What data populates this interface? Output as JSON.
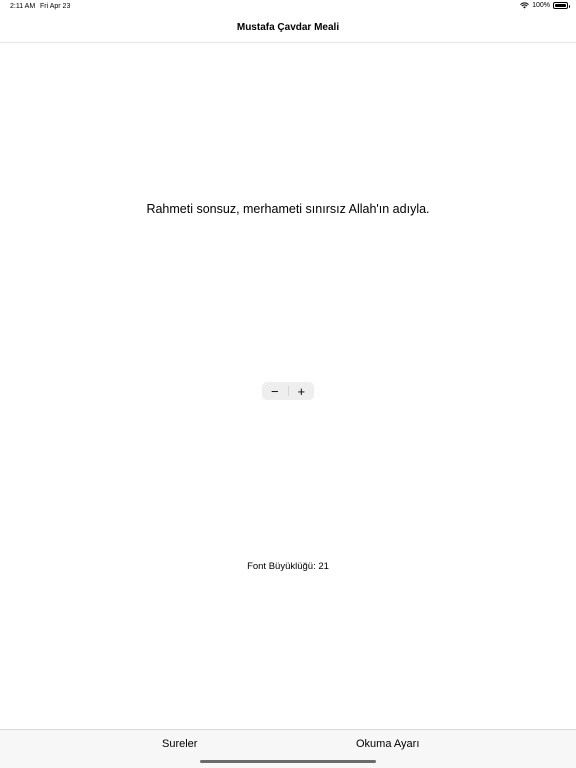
{
  "status_bar": {
    "time": "2:11 AM",
    "date": "Fri Apr 23",
    "battery": "100%",
    "battery_level": 1.0,
    "wifi_icon": "wifi-icon",
    "battery_icon": "battery-icon"
  },
  "nav": {
    "title": "Mustafa Çavdar Meali"
  },
  "content": {
    "verse": "Rahmeti sonsuz, merhameti sınırsız Allah'ın adıyla.",
    "stepper": {
      "decrement": "−",
      "increment": "+"
    },
    "font_size_label": "Font Büyüklüğü: 21"
  },
  "tab_bar": {
    "items": [
      {
        "label": "Sureler"
      },
      {
        "label": "Okuma Ayarı"
      }
    ]
  },
  "colors": {
    "background": "#ffffff",
    "stepper_bg": "#eeeeef",
    "tab_bar_bg": "#f7f7f7",
    "text": "#000000"
  }
}
